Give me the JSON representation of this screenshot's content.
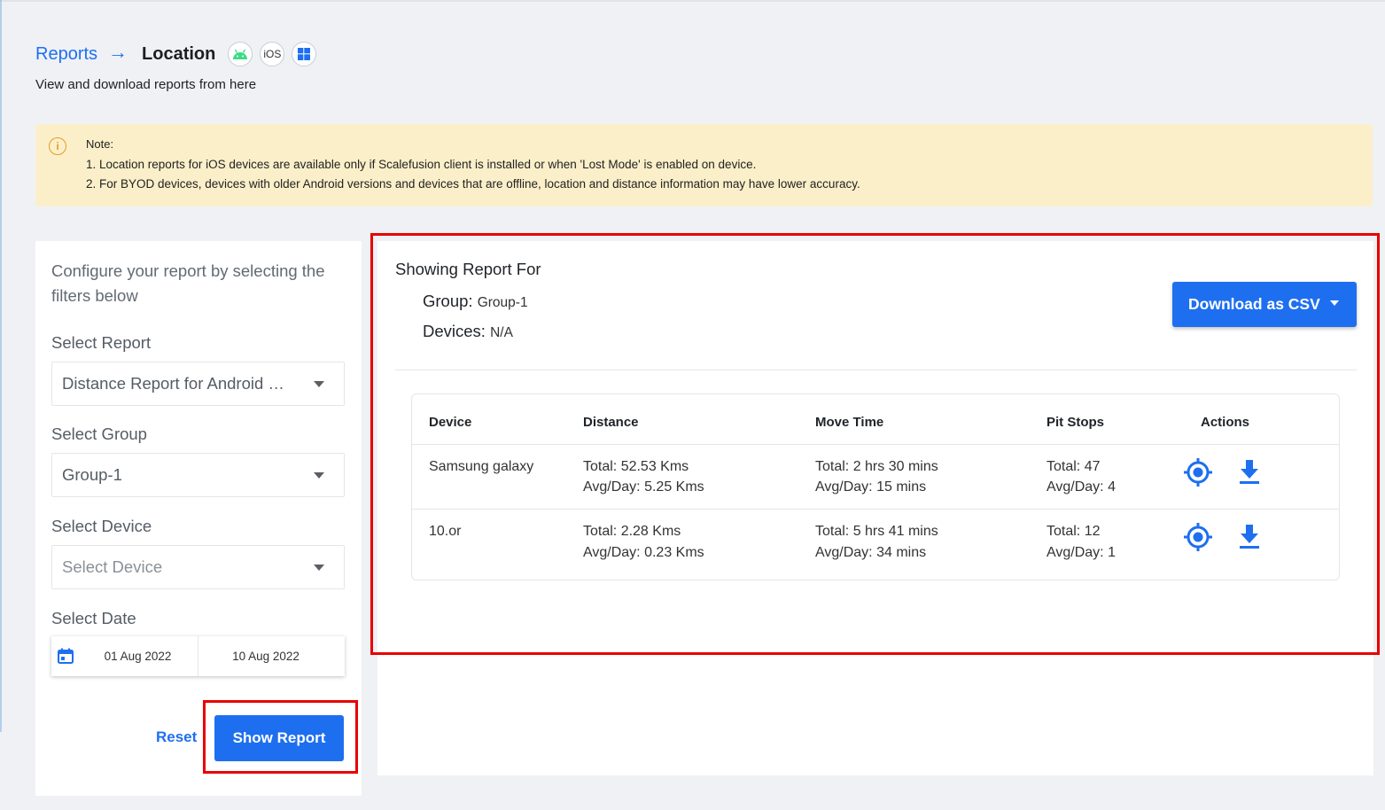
{
  "breadcrumb": {
    "parent": "Reports",
    "arrow": "→",
    "current": "Location",
    "ios_badge": "iOS"
  },
  "subtitle": "View and download reports from here",
  "note": {
    "title": "Note:",
    "line1": "1. Location reports for iOS devices are available only if Scalefusion client is installed or when 'Lost Mode' is enabled on device.",
    "line2": "2. For BYOD devices, devices with older Android versions and devices that are offline, location and distance information may have lower accuracy."
  },
  "config": {
    "heading": "Configure your report by selecting the filters below",
    "report_label": "Select Report",
    "report_value": "Distance Report for Android Devices",
    "group_label": "Select Group",
    "group_value": "Group-1",
    "device_label": "Select Device",
    "device_placeholder": "Select Device",
    "date_label": "Select Date",
    "date_from": "01 Aug 2022",
    "date_to": "10 Aug 2022",
    "reset_label": "Reset",
    "show_label": "Show Report"
  },
  "report": {
    "heading": "Showing Report For",
    "group_key": "Group:",
    "group_value": "Group-1",
    "devices_key": "Devices:",
    "devices_value": "N/A",
    "csv_label": "Download as CSV",
    "columns": [
      "Device",
      "Distance",
      "Move Time",
      "Pit Stops",
      "Actions"
    ],
    "rows": [
      {
        "device": "Samsung galaxy",
        "distance_total": "Total: 52.53 Kms",
        "distance_avg": "Avg/Day: 5.25 Kms",
        "move_total": "Total: 2 hrs 30 mins",
        "move_avg": "Avg/Day: 15 mins",
        "pit_total": "Total: 47",
        "pit_avg": "Avg/Day: 4"
      },
      {
        "device": "10.or",
        "distance_total": "Total: 2.28 Kms",
        "distance_avg": "Avg/Day: 0.23 Kms",
        "move_total": "Total: 5 hrs 41 mins",
        "move_avg": "Avg/Day: 34 mins",
        "pit_total": "Total: 12",
        "pit_avg": "Avg/Day: 1"
      }
    ]
  },
  "colors": {
    "accent": "#1e6ff0",
    "note_bg": "#fbefc9",
    "highlight": "#e80000",
    "page_bg": "#eff1f5"
  }
}
